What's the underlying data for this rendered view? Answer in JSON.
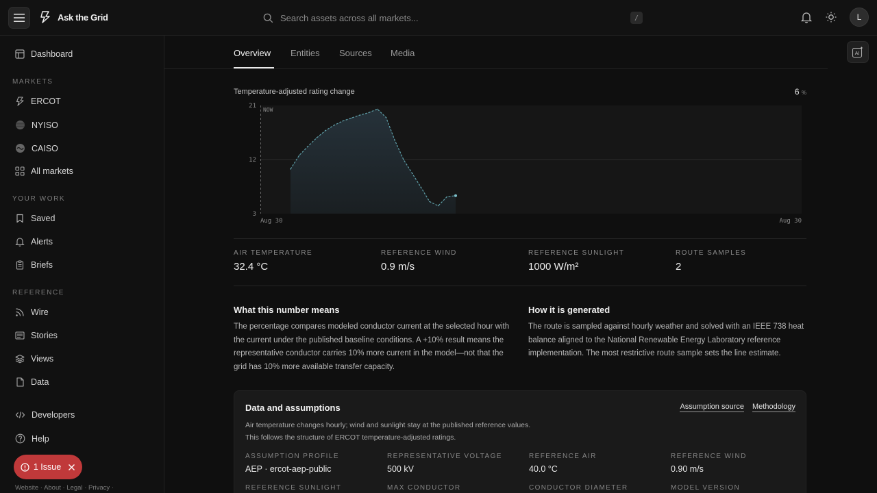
{
  "app": {
    "name": "Ask the Grid",
    "avatar_initial": "L"
  },
  "search": {
    "placeholder": "Search assets across all markets...",
    "shortcut": "/"
  },
  "sidebar": {
    "dashboard": "Dashboard",
    "markets_title": "MARKETS",
    "markets": [
      "ERCOT",
      "NYISO",
      "CAISO",
      "All markets"
    ],
    "work_title": "YOUR WORK",
    "work": [
      "Saved",
      "Alerts",
      "Briefs"
    ],
    "reference_title": "REFERENCE",
    "reference": [
      "Wire",
      "Stories",
      "Views",
      "Data"
    ],
    "developers": "Developers",
    "help": "Help",
    "issue_label": "1 Issue",
    "footer": "Website · About · Legal · Privacy ·"
  },
  "tabs": [
    "Overview",
    "Entities",
    "Sources",
    "Media"
  ],
  "ai_label": "AI",
  "chart": {
    "title": "Temperature-adjusted rating change",
    "current_value": "6",
    "current_unit": "%",
    "now_label": "NOW"
  },
  "chart_data": {
    "type": "area",
    "title": "Temperature-adjusted rating change",
    "ylim": [
      3,
      21
    ],
    "y_ticks": [
      "21",
      "12",
      "3"
    ],
    "x_ticks": [
      "Aug 30",
      "Aug 30"
    ],
    "grid": true,
    "series": [
      {
        "values": [
          10.4,
          12.7,
          14.2,
          15.6,
          16.8,
          17.7,
          18.4,
          18.9,
          19.4,
          19.8,
          20.4,
          19.0,
          15.2,
          12.0,
          9.7,
          7.4,
          5.0,
          4.3,
          5.8,
          6.0
        ]
      }
    ]
  },
  "stats": [
    {
      "label": "AIR TEMPERATURE",
      "value": "32.4 °C"
    },
    {
      "label": "REFERENCE WIND",
      "value": "0.9 m/s"
    },
    {
      "label": "REFERENCE SUNLIGHT",
      "value": "1000 W/m²"
    },
    {
      "label": "ROUTE SAMPLES",
      "value": "2"
    }
  ],
  "explain": {
    "left_title": "What this number means",
    "left_body": "The percentage compares modeled conductor current at the selected hour with the current under the published baseline conditions. A +10% result means the representative conductor carries 10% more current in the model—not that the grid has 10% more available transfer capacity.",
    "right_title": "How it is generated",
    "right_body": "The route is sampled against hourly weather and solved with an IEEE 738 heat balance aligned to the National Renewable Energy Laboratory reference implementation. The most restrictive route sample sets the line estimate."
  },
  "assumptions": {
    "title": "Data and assumptions",
    "link_source": "Assumption source",
    "link_method": "Methodology",
    "desc_1": "Air temperature changes hourly; wind and sunlight stay at the published reference values.",
    "desc_2": "This follows the structure of ERCOT temperature-adjusted ratings.",
    "items": [
      {
        "label": "ASSUMPTION PROFILE",
        "value": "AEP · ercot-aep-public"
      },
      {
        "label": "REPRESENTATIVE VOLTAGE",
        "value": "500 kV"
      },
      {
        "label": "REFERENCE AIR",
        "value": "40.0 °C"
      },
      {
        "label": "REFERENCE WIND",
        "value": "0.90 m/s"
      },
      {
        "label": "REFERENCE SUNLIGHT",
        "value": ""
      },
      {
        "label": "MAX CONDUCTOR",
        "value": ""
      },
      {
        "label": "CONDUCTOR DIAMETER",
        "value": ""
      },
      {
        "label": "MODEL VERSION",
        "value": ""
      }
    ]
  }
}
